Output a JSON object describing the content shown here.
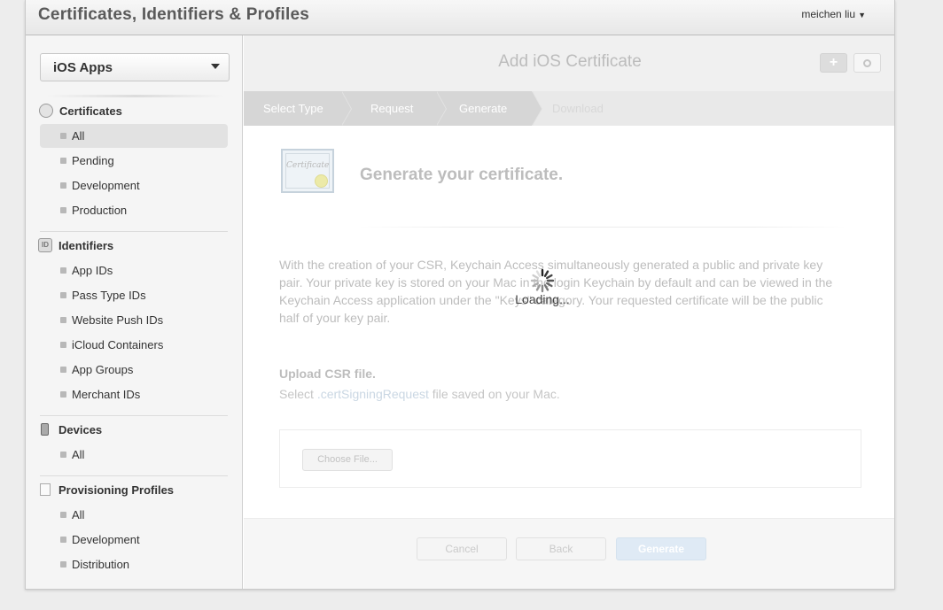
{
  "app": {
    "title": "Certificates, Identifiers & Profiles",
    "user": "meichen liu"
  },
  "sidebar": {
    "platform": "iOS Apps",
    "sections": [
      {
        "title": "Certificates",
        "icon": "certificate-icon",
        "items": [
          "All",
          "Pending",
          "Development",
          "Production"
        ]
      },
      {
        "title": "Identifiers",
        "icon": "id-icon",
        "icon_text": "ID",
        "items": [
          "App IDs",
          "Pass Type IDs",
          "Website Push IDs",
          "iCloud Containers",
          "App Groups",
          "Merchant IDs"
        ]
      },
      {
        "title": "Devices",
        "icon": "device-icon",
        "items": [
          "All"
        ]
      },
      {
        "title": "Provisioning Profiles",
        "icon": "profile-icon",
        "items": [
          "All",
          "Development",
          "Distribution"
        ]
      }
    ],
    "active_item": "Certificates / All"
  },
  "main": {
    "title": "Add iOS Certificate",
    "add_icon": "plus-icon",
    "search_icon": "search-icon",
    "steps": [
      "Select Type",
      "Request",
      "Generate",
      "Download"
    ],
    "current_step": "Generate",
    "cert_thumb_text": "Certificate",
    "heading": "Generate your certificate.",
    "description": "With the creation of your CSR, Keychain Access simultaneously generated a public and private key pair. Your private key is stored on your Mac in the login Keychain by default and can be viewed in the Keychain Access application under the \"Keys\" category. Your requested certificate will be the public half of your key pair.",
    "upload_title": "Upload CSR file.",
    "upload_sub_prefix": "Select ",
    "upload_sub_ext": ".certSigningRequest",
    "upload_sub_suffix": " file saved on your Mac.",
    "choose_file": "Choose File...",
    "buttons": {
      "cancel": "Cancel",
      "back": "Back",
      "generate": "Generate"
    },
    "loading": "Loading..."
  },
  "colors": {
    "accent_disabled": "#dfeaf5",
    "page_bg": "#ededed"
  }
}
